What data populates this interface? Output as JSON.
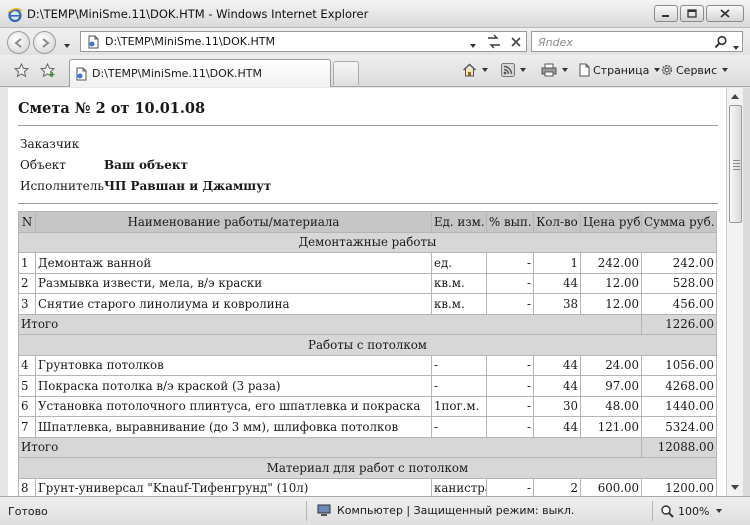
{
  "window": {
    "title": "D:\\TEMP\\MiniSme.11\\DOK.HTM - Windows Internet Explorer"
  },
  "address_bar": {
    "url": "D:\\TEMP\\MiniSme.11\\DOK.HTM",
    "search_placeholder": "Яndex"
  },
  "tab": {
    "label": "D:\\TEMP\\MiniSme.11\\DOK.HTM"
  },
  "command_bar": {
    "page_label": "Страница",
    "tools_label": "Сервис"
  },
  "document": {
    "title_prefix": "Смета № 2",
    "title_from": "от",
    "title_date": "10.01.08",
    "customer_label": "Заказчик",
    "customer_value": "",
    "object_label": "Объект",
    "object_value": "Ваш объект",
    "contractor_label": "Исполнитель",
    "contractor_value": "ЧП Равшан и Джамшут",
    "table": {
      "headers": [
        "N",
        "Наименование работы/материала",
        "Ед. изм.",
        "% вып.",
        "Кол-во",
        "Цена руб.",
        "Сумма руб."
      ],
      "sections": [
        {
          "title": "Демонтажные работы",
          "rows": [
            {
              "n": "1",
              "name": "Демонтаж ванной",
              "unit": "ед.",
              "pct": "-",
              "qty": "1",
              "price": "242.00",
              "sum": "242.00"
            },
            {
              "n": "2",
              "name": "Размывка извести, мела, в/э краски",
              "unit": "кв.м.",
              "pct": "-",
              "qty": "44",
              "price": "12.00",
              "sum": "528.00"
            },
            {
              "n": "3",
              "name": "Снятие старого линолиума и ковролина",
              "unit": "кв.м.",
              "pct": "-",
              "qty": "38",
              "price": "12.00",
              "sum": "456.00"
            }
          ],
          "total_label": "Итого",
          "total_value": "1226.00"
        },
        {
          "title": "Работы с потолком",
          "rows": [
            {
              "n": "4",
              "name": "Грунтовка потолков",
              "unit": "-",
              "pct": "-",
              "qty": "44",
              "price": "24.00",
              "sum": "1056.00"
            },
            {
              "n": "5",
              "name": "Покраска потолка в/э краской (3 раза)",
              "unit": "-",
              "pct": "-",
              "qty": "44",
              "price": "97.00",
              "sum": "4268.00"
            },
            {
              "n": "6",
              "name": "Установка потолочного плинтуса, его шпатлевка и покраска",
              "unit": "1пог.м.",
              "pct": "-",
              "qty": "30",
              "price": "48.00",
              "sum": "1440.00"
            },
            {
              "n": "7",
              "name": "Шпатлевка, выравнивание (до 3 мм), шлифовка потолков",
              "unit": "-",
              "pct": "-",
              "qty": "44",
              "price": "121.00",
              "sum": "5324.00"
            }
          ],
          "total_label": "Итого",
          "total_value": "12088.00"
        },
        {
          "title": "Материал для работ с потолком",
          "rows": [
            {
              "n": "8",
              "name": "Грунт-универсал \"Knauf-Тифенгрунд\" (10л)",
              "unit": "канистра",
              "pct": "-",
              "qty": "2",
              "price": "600.00",
              "sum": "1200.00"
            }
          ]
        }
      ]
    }
  },
  "status_bar": {
    "ready_text": "Готово",
    "zone_text": "Компьютер | Защищенный режим: выкл.",
    "zoom_text": "100%"
  },
  "colors": {
    "header_bg": "#c6c6c6",
    "section_bg": "#d7d7d7",
    "grid": "#b5b5b5"
  }
}
